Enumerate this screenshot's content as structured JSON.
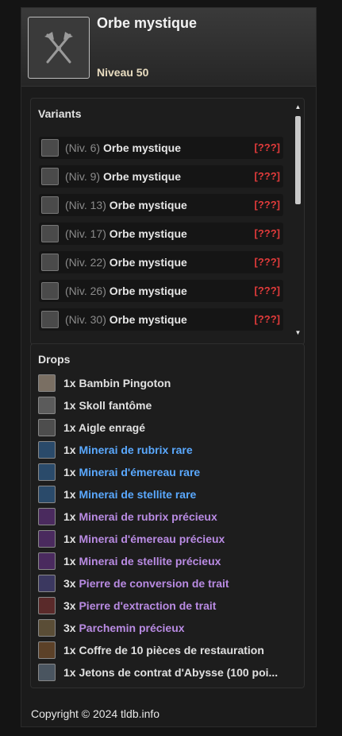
{
  "header": {
    "title": "Orbe mystique",
    "level": "Niveau 50",
    "portrait_icon": "crossed-axes-icon"
  },
  "variants": {
    "title": "Variants",
    "items": [
      {
        "level": "(Niv. 6)",
        "name": "Orbe mystique",
        "tag": "[???]"
      },
      {
        "level": "(Niv. 9)",
        "name": "Orbe mystique",
        "tag": "[???]"
      },
      {
        "level": "(Niv. 13)",
        "name": "Orbe mystique",
        "tag": "[???]"
      },
      {
        "level": "(Niv. 17)",
        "name": "Orbe mystique",
        "tag": "[???]"
      },
      {
        "level": "(Niv. 22)",
        "name": "Orbe mystique",
        "tag": "[???]"
      },
      {
        "level": "(Niv. 26)",
        "name": "Orbe mystique",
        "tag": "[???]"
      },
      {
        "level": "(Niv. 30)",
        "name": "Orbe mystique",
        "tag": "[???]"
      }
    ]
  },
  "drops": {
    "title": "Drops",
    "items": [
      {
        "qty": "1x",
        "name": "Bambin Pingoton",
        "color": "#e0e0e0",
        "icon": "penguin-icon",
        "icon_color": "#7a6f63"
      },
      {
        "qty": "1x",
        "name": "Skoll fantôme",
        "color": "#e0e0e0",
        "icon": "wolf-icon",
        "icon_color": "#5b5b5b"
      },
      {
        "qty": "1x",
        "name": "Aigle enragé",
        "color": "#e0e0e0",
        "icon": "eagle-icon",
        "icon_color": "#4d4d4d"
      },
      {
        "qty": "1x",
        "name": "Minerai de rubrix rare",
        "color": "#5aa9ff",
        "icon": "red-ore-icon",
        "icon_color": "#2a4a6a"
      },
      {
        "qty": "1x",
        "name": "Minerai d'émereau rare",
        "color": "#5aa9ff",
        "icon": "green-ore-icon",
        "icon_color": "#2a4a6a"
      },
      {
        "qty": "1x",
        "name": "Minerai de stellite rare",
        "color": "#5aa9ff",
        "icon": "yellow-ore-icon",
        "icon_color": "#2a4a6a"
      },
      {
        "qty": "1x",
        "name": "Minerai de rubrix précieux",
        "color": "#b98be3",
        "icon": "red-ore-icon",
        "icon_color": "#4a2a5e"
      },
      {
        "qty": "1x",
        "name": "Minerai d'émereau précieux",
        "color": "#b98be3",
        "icon": "green-ore-icon",
        "icon_color": "#4a2a5e"
      },
      {
        "qty": "1x",
        "name": "Minerai de stellite précieux",
        "color": "#b98be3",
        "icon": "yellow-ore-icon",
        "icon_color": "#4a2a5e"
      },
      {
        "qty": "3x",
        "name": "Pierre de conversion de trait",
        "color": "#b98be3",
        "icon": "blue-stone-icon",
        "icon_color": "#3b3860"
      },
      {
        "qty": "3x",
        "name": "Pierre d'extraction de trait",
        "color": "#b98be3",
        "icon": "red-stone-icon",
        "icon_color": "#5a2a2a"
      },
      {
        "qty": "3x",
        "name": "Parchemin précieux",
        "color": "#b98be3",
        "icon": "scroll-icon",
        "icon_color": "#5a4d36"
      },
      {
        "qty": "1x",
        "name": "Coffre de 10 pièces de restauration",
        "color": "#e0e0e0",
        "icon": "chest-icon",
        "icon_color": "#5c4128"
      },
      {
        "qty": "1x",
        "name": "Jetons de contrat d'Abysse (100 poi...",
        "color": "#e0e0e0",
        "icon": "token-icon",
        "icon_color": "#4a5560"
      }
    ]
  },
  "footer": {
    "copyright": "Copyright © 2024 tldb.info"
  }
}
